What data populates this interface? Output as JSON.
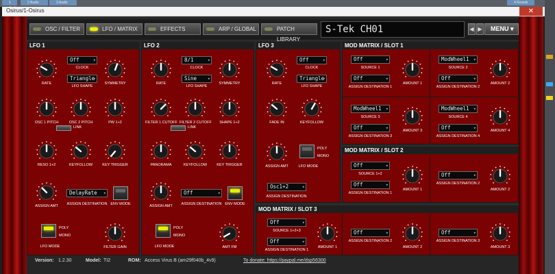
{
  "window": {
    "title": "Osirus/1-Osirus",
    "close_glyph": "✕"
  },
  "host": {
    "tracks": [
      "1 Audio",
      "2 Audio",
      "3 Audio",
      "4 Reverb"
    ]
  },
  "nav": {
    "tabs": [
      "OSC / FILTER",
      "LFO / MATRIX",
      "EFFECTS",
      "ARP / GLOBAL",
      "PATCH LIBRARY"
    ],
    "active": "LFO / MATRIX"
  },
  "patch_name": "S-Tek CH01",
  "menu_label": "MENU",
  "lfo1": {
    "title": "LFO 1",
    "rate": "RATE",
    "clock_value": "Off",
    "clock": "CLOCK",
    "shape_value": "Triangle",
    "shape": "LFO SHAPE",
    "symmetry": "SYMMETRY",
    "osc1_pitch": "OSC 1 PITCH",
    "osc2_pitch": "OSC 2 PITCH",
    "pw": "PW 1+2",
    "link": "LINK",
    "reso": "RESO 1+2",
    "keyfollow": "KEYFOLLOW",
    "key_trigger": "KEY TRIGGER",
    "assign_amt": "ASSIGN AMT",
    "assign_dest_value": "DelayRate",
    "assign_dest": "ASSIGN DESTINATION",
    "env_mode": "ENV MODE",
    "poly": "POLY",
    "mono": "MONO",
    "lfo_mode": "LFO MODE",
    "filter_gain": "FILTER GAIN"
  },
  "lfo2": {
    "title": "LFO 2",
    "rate": "RATE",
    "clock_value": "8/1",
    "clock": "CLOCK",
    "shape_value": "Sine",
    "shape": "LFO SHAPE",
    "symmetry": "SYMMETRY",
    "cutoff1": "FILTER 1 CUTOFF",
    "cutoff2": "FILTER 2 CUTOFF",
    "shape12": "SHAPE 1+2",
    "link": "LINK",
    "panorama": "PANORAMA",
    "keyfollow": "KEYFOLLOW",
    "key_trigger": "KEY TRIGGER",
    "assign_amt": "ASSIGN AMT",
    "assign_dest_value": "Off",
    "assign_dest": "ASSIGN DESTINATION",
    "env_mode": "ENV MODE",
    "poly": "POLY",
    "mono": "MONO",
    "lfo_mode": "LFO MODE",
    "amt_fm": "AMT FM"
  },
  "lfo3": {
    "title": "LFO 3",
    "rate": "RATE",
    "clock_value": "Off",
    "clock": "CLOCK",
    "shape_value": "Triangle",
    "shape": "LFO SHAPE",
    "fade_in": "FADE IN",
    "keyfollow": "KEYFOLLOW",
    "assign_amt": "ASSIGN AMT",
    "assign_dest_value": "Osc1+2",
    "assign_dest": "ASSIGN DESTINATION",
    "poly": "POLY",
    "mono": "MONO",
    "lfo_mode": "LFO MODE"
  },
  "matrix1": {
    "title": "MOD MATRIX / SLOT 1",
    "slots": [
      {
        "src_value": "Off",
        "src": "SOURCE 1",
        "d1": "Off",
        "d1l": "ASSIGN DESTINATION 1",
        "amt": "AMOUNT 1",
        "d2": "Off",
        "d2l": "ASSIGN DESTINATION 1",
        "amt2": "AMOUNT 1"
      },
      {
        "src_value": "ModWheel1",
        "src": "SOURCE 2",
        "d1": "Off",
        "d1l": "ASSIGN DESTINATION 2",
        "amt": "AMOUNT 2"
      },
      {
        "src_value": "ModWheel1",
        "src": "SOURCE 3",
        "d1": "Off",
        "d1l": "ASSIGN DESTINATION 3",
        "amt": "AMOUNT 3"
      },
      {
        "src_value": "ModWheel1",
        "src": "SOURCE 4",
        "d1": "Off",
        "d1l": "ASSIGN DESTINATION 4",
        "amt": "AMOUNT 4"
      }
    ]
  },
  "matrix2": {
    "title": "MOD MATRIX / SLOT 2",
    "src_value": "Off",
    "src": "SOURCE 1+2",
    "d1": "Off",
    "d1l": "ASSIGN DESTINATION 1",
    "amt1": "AMOUNT 1",
    "d2": "Off",
    "d2l": "ASSIGN DESTINATION 2",
    "amt2": "AMOUNT 2"
  },
  "matrix3": {
    "title": "MOD MATRIX / SLOT 3",
    "src_value": "Off",
    "src": "SOURCE 1+2+3",
    "d1": "Off",
    "d1l": "ASSIGN DESTINATION 1",
    "amt1": "AMOUNT 1",
    "d2": "Off",
    "d2l": "ASSIGN DESTINATION 2",
    "amt2": "AMOUNT 2",
    "d3": "Off",
    "d3l": "ASSIGN DESTINATION 3",
    "amt3": "AMOUNT 3"
  },
  "footer": {
    "version_label": "Version:",
    "version": "1.2.30",
    "model_label": "Model:",
    "model": "TI2",
    "rom_label": "ROM:",
    "rom": "Access Virus B (am29f040b_4v9)",
    "donate": "To donate: https://paypal.me/dsp56300"
  },
  "knob_scale": {
    "min": "0",
    "max": "MAX"
  }
}
